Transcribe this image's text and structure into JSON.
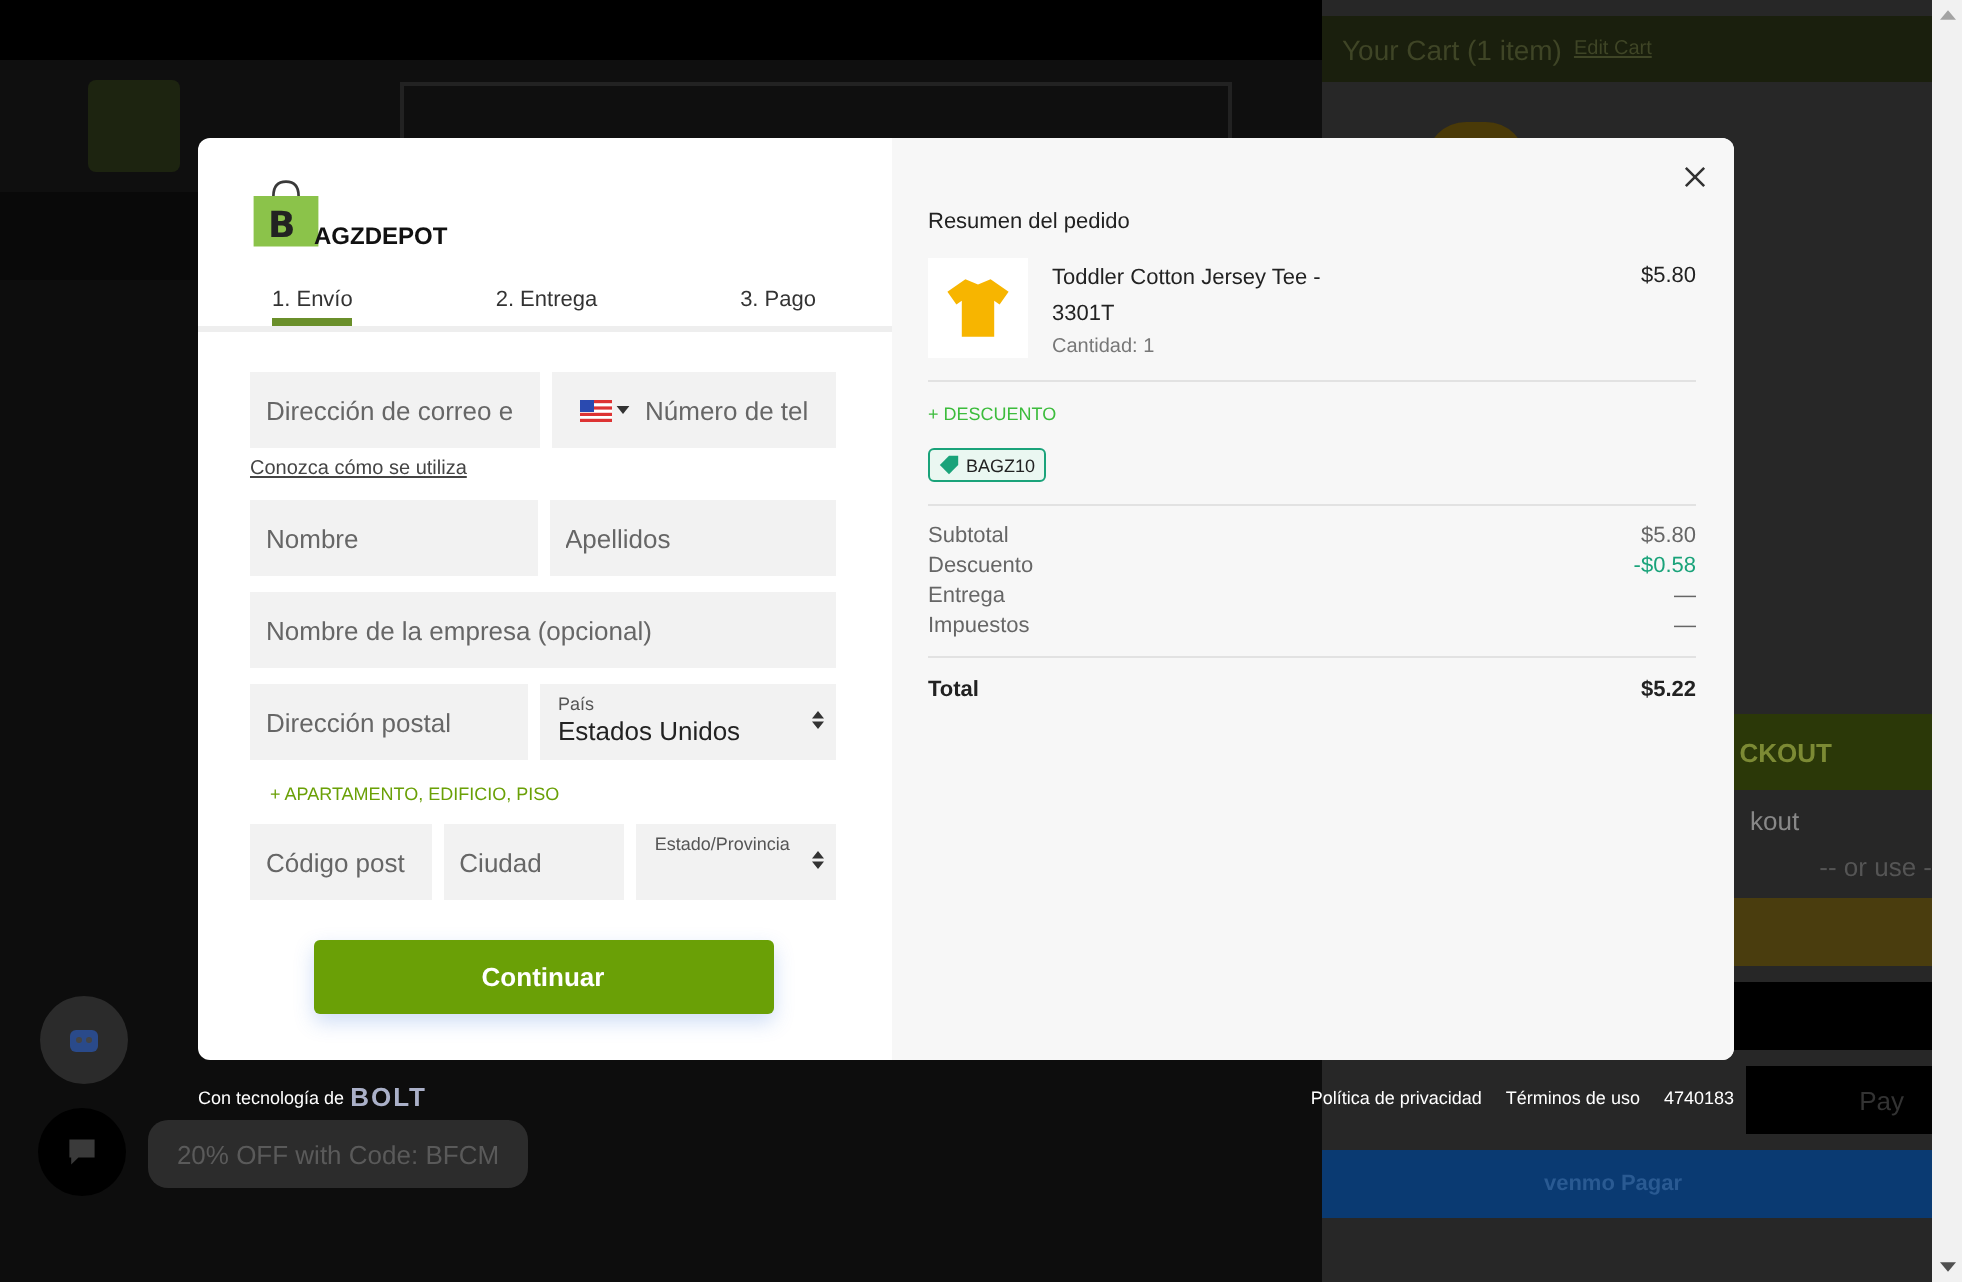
{
  "cart_panel": {
    "title": "Your Cart (1 item)",
    "edit_link": "Edit Cart",
    "buttons": [
      {
        "kind": "checkout",
        "text": "CKOUT"
      },
      {
        "kind": "note",
        "text": "kout"
      },
      {
        "kind": "divider",
        "text": "-- or use -"
      },
      {
        "kind": "yellow"
      },
      {
        "kind": "black"
      },
      {
        "kind": "black",
        "text": "Pay"
      },
      {
        "kind": "venmo",
        "text": "venmo Pagar"
      }
    ]
  },
  "promo": {
    "text": "20% OFF with Code: BFCM"
  },
  "modal": {
    "logo": {
      "initial": "B",
      "text": "AGZDEPOT"
    },
    "steps": [
      {
        "label": "1. Envío",
        "selected": true
      },
      {
        "label": "2. Entrega",
        "selected": false
      },
      {
        "label": "3. Pago",
        "selected": false
      }
    ],
    "rows": [
      {
        "fields": [
          {
            "kind": "input",
            "placeholder": "Dirección de correo e"
          },
          {
            "kind": "phone",
            "placeholder": "Número de tel"
          }
        ]
      },
      {
        "link": "Conozca cómo se utiliza"
      },
      {
        "fields": [
          {
            "kind": "input",
            "placeholder": "Nombre"
          },
          {
            "kind": "input",
            "placeholder": "Apellidos"
          }
        ]
      },
      {
        "fields": [
          {
            "kind": "input",
            "placeholder": "Nombre de la empresa (opcional)"
          }
        ]
      },
      {
        "fields": [
          {
            "kind": "input",
            "placeholder": "Dirección postal"
          },
          {
            "kind": "select",
            "label": "País",
            "value": "Estados Unidos"
          }
        ]
      },
      {
        "add_link": "+ APARTAMENTO, EDIFICIO, PISO"
      },
      {
        "fields": [
          {
            "kind": "input",
            "placeholder": "Código post"
          },
          {
            "kind": "input",
            "placeholder": "Ciudad"
          },
          {
            "kind": "select",
            "label": "Estado/Provincia"
          }
        ]
      }
    ],
    "continue_button": "Continuar",
    "summary": {
      "title": "Resumen del pedido",
      "item": {
        "name": "Toddler Cotton Jersey Tee - 3301T",
        "quantity": "Cantidad: 1",
        "price": "$5.80"
      },
      "discount_link": "+ DESCUENTO",
      "coupon": "BAGZ10",
      "totals": [
        {
          "kind": "normal",
          "label": "Subtotal",
          "value": "$5.80"
        },
        {
          "kind": "discount",
          "label": "Descuento",
          "value": "-$0.58"
        },
        {
          "kind": "normal",
          "label": "Entrega",
          "value": "—"
        },
        {
          "kind": "normal",
          "label": "Impuestos",
          "value": "—"
        }
      ],
      "total": {
        "label": "Total",
        "value": "$5.22"
      }
    }
  },
  "footer": {
    "powered_by": "Con tecnología de",
    "brand": "BOLT",
    "links": [
      "Política de privacidad",
      "Términos de uso"
    ],
    "code": "4740183"
  }
}
